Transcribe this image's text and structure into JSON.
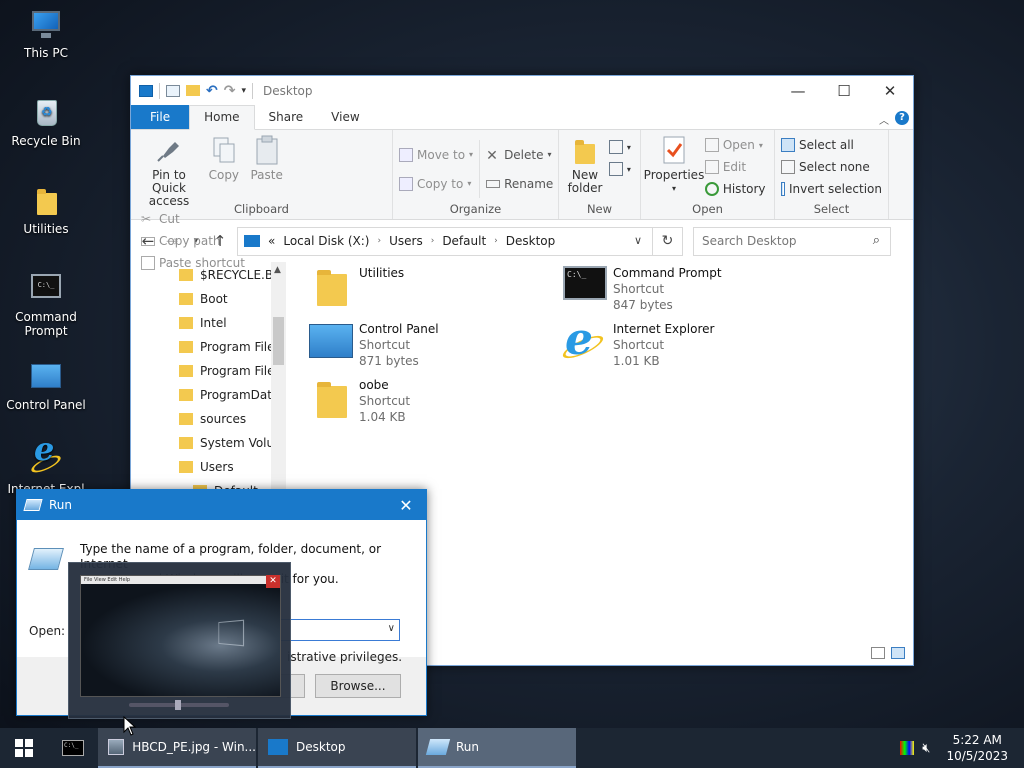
{
  "desktop": {
    "icons": [
      {
        "label": "This PC",
        "icon": "computer-icon"
      },
      {
        "label": "Recycle Bin",
        "icon": "recycle-bin-icon"
      },
      {
        "label": "Utilities",
        "icon": "folder-icon"
      },
      {
        "label": "Command Prompt",
        "icon": "command-prompt-icon"
      },
      {
        "label": "Control Panel",
        "icon": "control-panel-icon"
      },
      {
        "label": "Internet Expl",
        "icon": "internet-explorer-icon"
      }
    ]
  },
  "explorer": {
    "title": "Desktop",
    "window_buttons": {
      "minimize": "—",
      "maximize": "☐",
      "close": "✕"
    },
    "tabs": [
      "File",
      "Home",
      "Share",
      "View"
    ],
    "active_tab": "Home",
    "ribbon": {
      "clipboard": {
        "label": "Clipboard",
        "pin": "Pin to Quick access",
        "copy": "Copy",
        "paste": "Paste",
        "cut": "Cut",
        "copy_path": "Copy path",
        "paste_shortcut": "Paste shortcut"
      },
      "organize": {
        "label": "Organize",
        "move_to": "Move to",
        "copy_to": "Copy to",
        "delete": "Delete",
        "rename": "Rename"
      },
      "new": {
        "label": "New",
        "new_folder": "New folder"
      },
      "open": {
        "label": "Open",
        "properties": "Properties",
        "open": "Open",
        "edit": "Edit",
        "history": "History"
      },
      "select": {
        "label": "Select",
        "select_all": "Select all",
        "select_none": "Select none",
        "invert": "Invert selection"
      }
    },
    "address": {
      "overflow": "«",
      "segments": [
        "Local Disk (X:)",
        "Users",
        "Default",
        "Desktop"
      ]
    },
    "search_placeholder": "Search Desktop",
    "nav_items": [
      "$RECYCLE.BIN",
      "Boot",
      "Intel",
      "Program Files",
      "Program Files",
      "ProgramData",
      "sources",
      "System Volum",
      "Users",
      "Default"
    ],
    "files": [
      {
        "name": "Utilities",
        "type": "",
        "size": "",
        "icon": "folder-icon"
      },
      {
        "name": "Command Prompt",
        "type": "Shortcut",
        "size": "847 bytes",
        "icon": "command-prompt-icon"
      },
      {
        "name": "Control Panel",
        "type": "Shortcut",
        "size": "871 bytes",
        "icon": "control-panel-icon"
      },
      {
        "name": "Internet Explorer",
        "type": "Shortcut",
        "size": "1.01 KB",
        "icon": "internet-explorer-icon"
      },
      {
        "name": "oobe",
        "type": "Shortcut",
        "size": "1.04 KB",
        "icon": "folder-icon"
      }
    ]
  },
  "run_dialog": {
    "title": "Run",
    "description_line1": "Type the name of a program, folder, document, or Internet",
    "description_line2": "resource, and Windows will open it for you.",
    "open_label": "Open:",
    "input_value": "",
    "admin_note": "istrative privileges.",
    "browse_label": "Browse..."
  },
  "thumbnail": {
    "menu_text": "File  View  Edit  Help"
  },
  "taskbar": {
    "apps": [
      {
        "label": "HBCD_PE.jpg - Win...",
        "active": false
      },
      {
        "label": "Desktop",
        "active": false
      },
      {
        "label": "Run",
        "active": true
      }
    ],
    "time": "5:22 AM",
    "date": "10/5/2023"
  },
  "colors": {
    "accent": "#1979ca",
    "taskbar": "#1c2633",
    "folder": "#f3c94f"
  }
}
